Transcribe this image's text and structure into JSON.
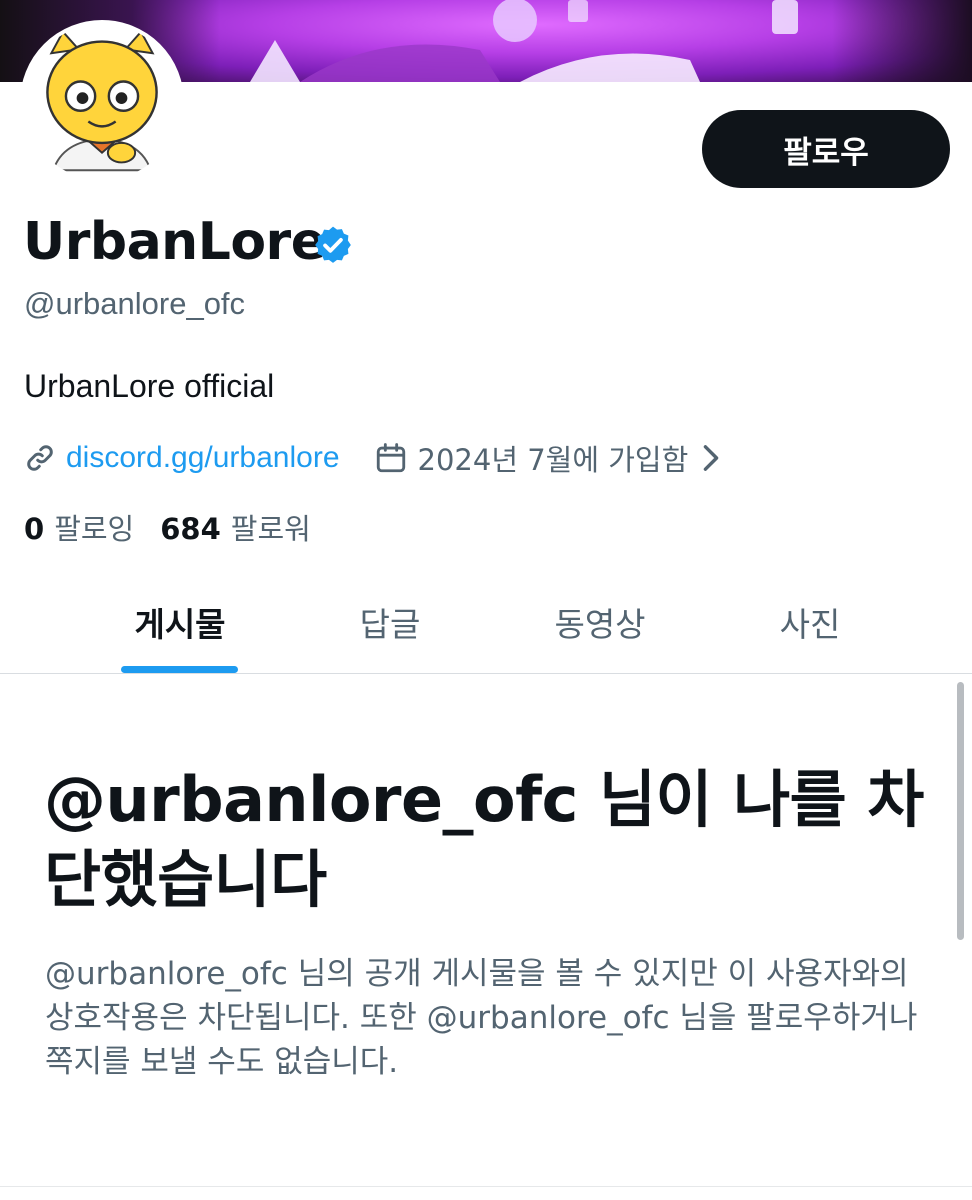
{
  "profile": {
    "display_name": "UrbanLore",
    "handle": "@urbanlore_ofc",
    "bio": "UrbanLore official",
    "link": "discord.gg/urbanlore",
    "joined": "2024년 7월에 가입함",
    "verified": true
  },
  "actions": {
    "follow_label": "팔로우"
  },
  "stats": {
    "following_count": "0",
    "following_label": "팔로잉",
    "followers_count": "684",
    "followers_label": "팔로워"
  },
  "tabs": [
    {
      "label": "게시물",
      "active": true
    },
    {
      "label": "답글",
      "active": false
    },
    {
      "label": "동영상",
      "active": false
    },
    {
      "label": "사진",
      "active": false
    }
  ],
  "blocked_notice": {
    "title": "@urbanlore_ofc 님이 나를 차단했습니다",
    "description": "@urbanlore_ofc 님의 공개 게시물을 볼 수 있지만 이 사용자와의 상호작용은 차단됩니다. 또한 @urbanlore_ofc 님을 팔로우하거나 쪽지를 보낼 수도 없습니다."
  },
  "icons": {
    "link": "link-icon",
    "calendar": "calendar-icon",
    "verified": "verified-badge-icon",
    "chevron": "chevron-right-icon"
  },
  "colors": {
    "accent": "#1d9bf0",
    "text_primary": "#0f1419",
    "text_secondary": "#536471",
    "button_bg": "#0f1419"
  }
}
